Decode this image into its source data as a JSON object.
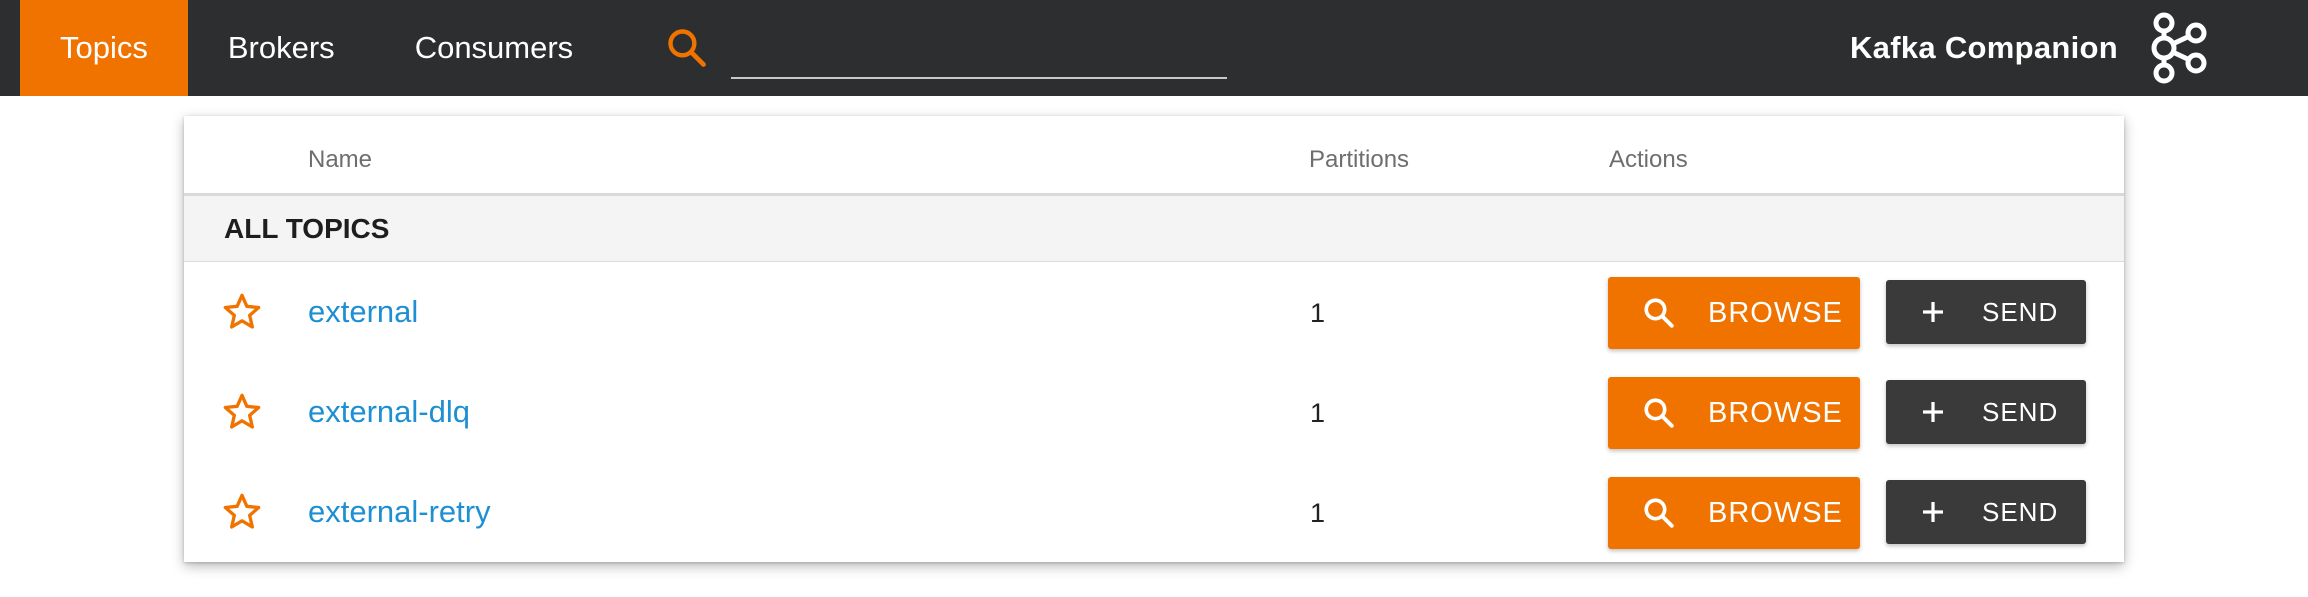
{
  "nav": {
    "items": [
      {
        "label": "Topics",
        "active": true
      },
      {
        "label": "Brokers",
        "active": false
      },
      {
        "label": "Consumers",
        "active": false
      }
    ],
    "search": {
      "value": "",
      "placeholder": ""
    }
  },
  "brand": {
    "name": "Kafka Companion",
    "logo_icon": "kafka-logo-icon"
  },
  "table": {
    "headers": {
      "name": "Name",
      "partitions": "Partitions",
      "actions": "Actions"
    },
    "group_label": "ALL TOPICS",
    "rows": [
      {
        "name": "external",
        "partitions": "1",
        "favorite": false
      },
      {
        "name": "external-dlq",
        "partitions": "1",
        "favorite": false
      },
      {
        "name": "external-retry",
        "partitions": "1",
        "favorite": false
      }
    ],
    "actions": {
      "browse_label": "BROWSE",
      "send_label": "SEND"
    }
  },
  "colors": {
    "accent": "#f07300",
    "topbar": "#2d2e30",
    "link": "#1d8fd2",
    "send_button": "#3a3a3b"
  },
  "icons": {
    "search": "search-icon",
    "star": "star-outline-icon",
    "plus": "plus-icon"
  }
}
